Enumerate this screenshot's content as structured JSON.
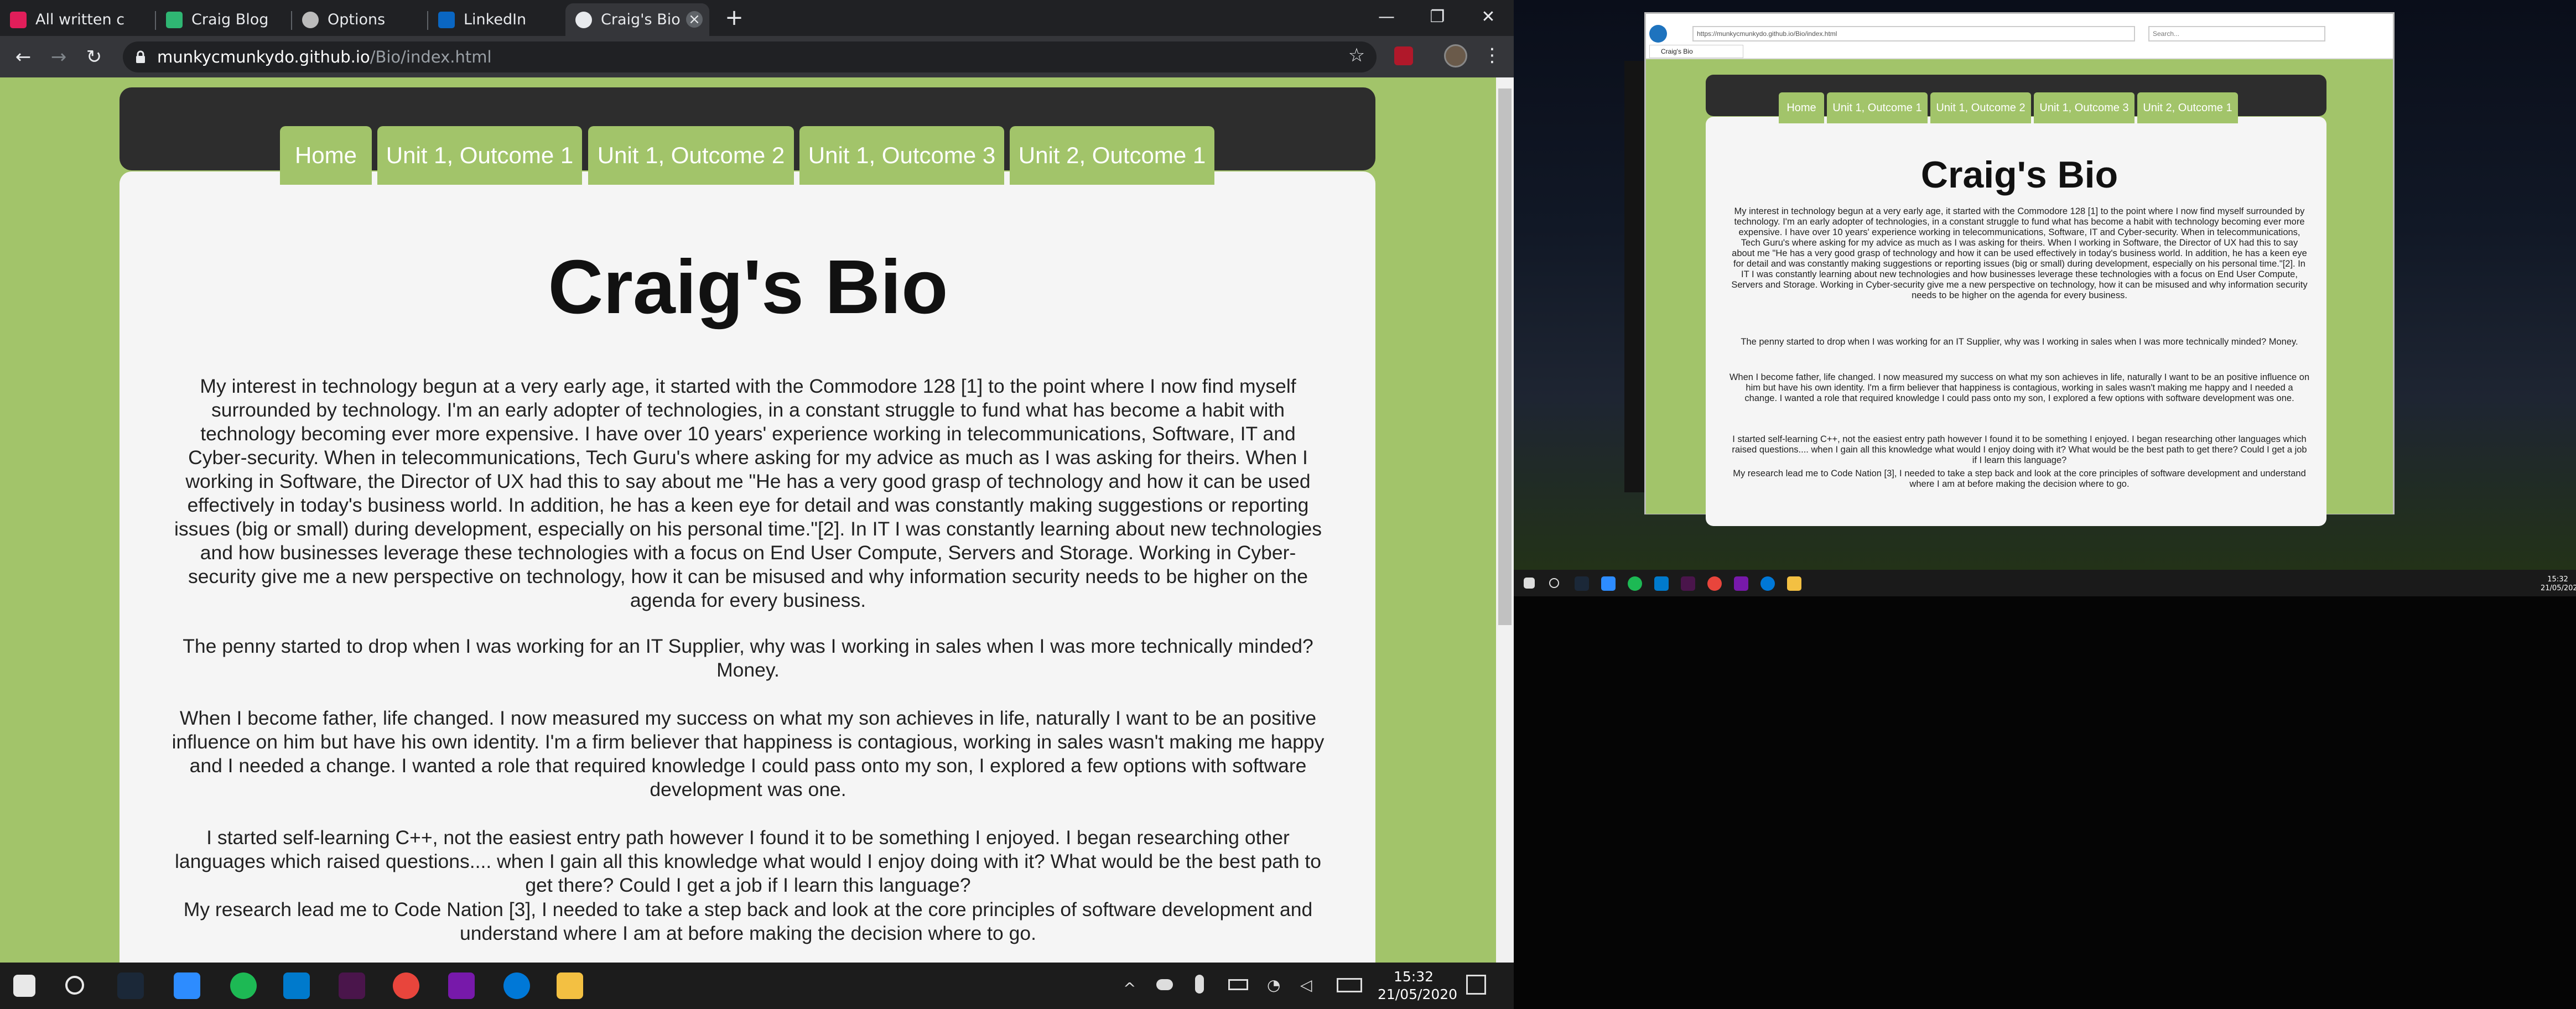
{
  "browser": {
    "tabs": [
      {
        "label": "All written c",
        "icon": "slack-icon",
        "color": "#e01e5a"
      },
      {
        "label": "Craig Blog",
        "icon": "blogger-icon",
        "color": "#2fb673"
      },
      {
        "label": "Options",
        "icon": "github-icon",
        "color": "#bbbbbb"
      },
      {
        "label": "LinkedIn",
        "icon": "linkedin-icon",
        "color": "#0a66c2"
      },
      {
        "label": "Craig's Bio",
        "icon": "globe-icon",
        "color": "#e8eaed"
      }
    ],
    "url_host": "munkycmunkydo.github.io",
    "url_path": "/Bio/index.html"
  },
  "page": {
    "nav": [
      "Home",
      "Unit 1, Outcome 1",
      "Unit 1, Outcome 2",
      "Unit 1, Outcome 3",
      "Unit 2, Outcome 1"
    ],
    "title": "Craig's Bio",
    "paragraphs": [
      "My interest in technology begun at a very early age, it started with the Commodore 128 [1] to the point where I now find myself surrounded by technology. I'm an early adopter of technologies, in a constant struggle to fund what has become a habit with technology becoming ever more expensive. I have over 10 years' experience working in telecommunications, Software, IT and Cyber-security. When in telecommunications, Tech Guru's where asking for my advice as much as I was asking for theirs. When I working in Software, the Director of UX had this to say about me \"He has a very good grasp of technology and how it can be used effectively in today's business world. In addition, he has a keen eye for detail and was constantly making suggestions or reporting issues (big or small) during development, especially on his personal time.\"[2]. In IT I was constantly learning about new technologies and how businesses leverage these technologies with a focus on End User Compute, Servers and Storage. Working in Cyber-security give me a new perspective on technology, how it can be misused and why information security needs to be higher on the agenda for every business.",
      "The penny started to drop when I was working for an IT Supplier, why was I working in sales when I was more technically minded? Money.",
      "When I become father, life changed. I now measured my success on what my son achieves in life, naturally I want to be an positive influence on him but have his own identity. I'm a firm believer that happiness is contagious, working in sales wasn't making me happy and I needed a change. I wanted a role that required knowledge I could pass onto my son, I explored a few options with software development was one.",
      "I started self-learning C++, not the easiest entry path however I found it to be something I enjoyed. I began researching other languages which raised questions.... when I gain all this knowledge what would I enjoy doing with it? What would be the best path to get there? Could I get a job if I learn this language?",
      "My research lead me to Code Nation [3], I needed to take a step back and look at the core principles of software development and understand where I am at before making the decision where to go."
    ]
  },
  "taskbar": {
    "time": "15:32",
    "date": "21/05/2020",
    "apps": [
      "start-icon",
      "search-icon",
      "steam-icon",
      "zoom-icon",
      "spotify-icon",
      "vscode-icon",
      "slack-icon",
      "chrome-icon",
      "onenote-icon",
      "edge-icon",
      "file-explorer-icon"
    ]
  },
  "mini_window": {
    "tab_label": "Craig's Bio",
    "url": "https://munkycmunkydo.github.io/Bio/index.html",
    "search_placeholder": "Search...",
    "time": "15:32",
    "date": "21/05/2020"
  },
  "colors": {
    "page_green": "#a2c46a",
    "nav_dark": "#2d2d2d",
    "card": "#f5f5f5"
  }
}
